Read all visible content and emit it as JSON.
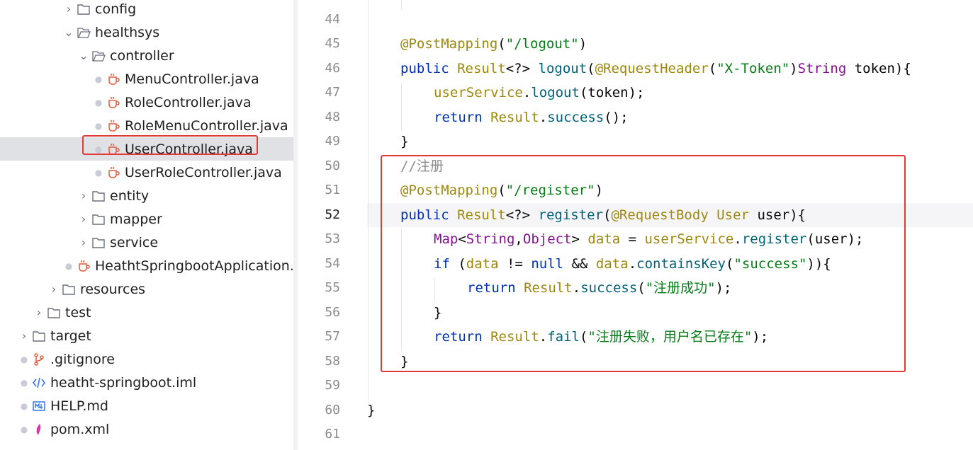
{
  "tree": {
    "items": [
      {
        "label": "config",
        "icon": "folder-icon",
        "expanded": false
      },
      {
        "label": "healthsys",
        "icon": "folder-open-icon",
        "expanded": true
      },
      {
        "label": "controller",
        "icon": "folder-open-icon",
        "expanded": true
      },
      {
        "label": "MenuController.java",
        "icon": "java-class-icon"
      },
      {
        "label": "RoleController.java",
        "icon": "java-class-icon"
      },
      {
        "label": "RoleMenuController.java",
        "icon": "java-class-icon"
      },
      {
        "label": "UserController.java",
        "icon": "java-class-icon",
        "selected": true
      },
      {
        "label": "UserRoleController.java",
        "icon": "java-class-icon"
      },
      {
        "label": "entity",
        "icon": "folder-icon",
        "expanded": false
      },
      {
        "label": "mapper",
        "icon": "folder-icon",
        "expanded": false
      },
      {
        "label": "service",
        "icon": "folder-icon",
        "expanded": false
      },
      {
        "label": "HeathtSpringbootApplication.j...",
        "icon": "java-class-icon"
      },
      {
        "label": "resources",
        "icon": "folder-icon",
        "expanded": false
      },
      {
        "label": "test",
        "icon": "folder-icon",
        "expanded": false
      },
      {
        "label": "target",
        "icon": "folder-icon",
        "expanded": false
      },
      {
        "label": ".gitignore",
        "icon": "git-icon"
      },
      {
        "label": "heatht-springboot.iml",
        "icon": "xml-icon"
      },
      {
        "label": "HELP.md",
        "icon": "markdown-icon"
      },
      {
        "label": "pom.xml",
        "icon": "maven-icon"
      }
    ]
  },
  "editor": {
    "current_line": "52",
    "lines": [
      {
        "no": "44",
        "code": ""
      },
      {
        "no": "45",
        "code": "@PostMapping(\"/logout\")"
      },
      {
        "no": "46",
        "code": "public Result<?> logout(@RequestHeader(\"X-Token\")String token){"
      },
      {
        "no": "47",
        "code": "userService.logout(token);"
      },
      {
        "no": "48",
        "code": "return Result.success();"
      },
      {
        "no": "49",
        "code": "}"
      },
      {
        "no": "50",
        "code": "//注册"
      },
      {
        "no": "51",
        "code": "@PostMapping(\"/register\")"
      },
      {
        "no": "52",
        "code": "public Result<?> register(@RequestBody User user){"
      },
      {
        "no": "53",
        "code": "Map<String,Object> data = userService.register(user);"
      },
      {
        "no": "54",
        "code": "if (data != null && data.containsKey(\"success\")){"
      },
      {
        "no": "55",
        "code": "return Result.success(\"注册成功\");"
      },
      {
        "no": "56",
        "code": "}"
      },
      {
        "no": "57",
        "code": "return Result.fail(\"注册失败，用户名已存在\");"
      },
      {
        "no": "58",
        "code": "}"
      },
      {
        "no": "59",
        "code": ""
      },
      {
        "no": "60",
        "code": "}"
      },
      {
        "no": "61",
        "code": ""
      }
    ]
  },
  "colors": {
    "keyword": "#0033b3",
    "annotation": "#9e880d",
    "string": "#067d17",
    "comment": "#8c8c8c",
    "method": "#00627a",
    "highlight_border": "#e03b3b",
    "selection": "#dfe1e5"
  }
}
